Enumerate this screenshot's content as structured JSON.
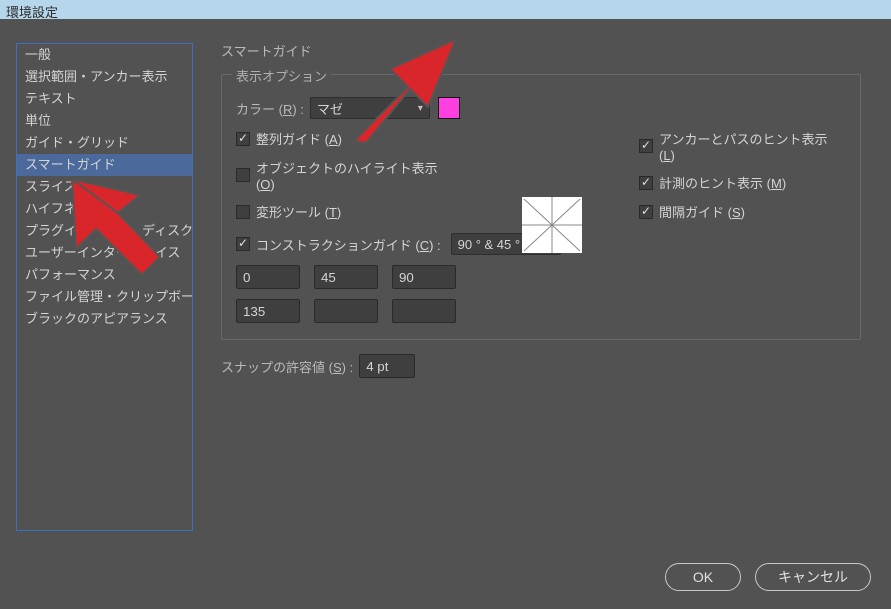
{
  "window": {
    "title": "環境設定"
  },
  "sidebar": {
    "items": [
      {
        "label": "一般"
      },
      {
        "label": "選択範囲・アンカー表示"
      },
      {
        "label": "テキスト"
      },
      {
        "label": "単位"
      },
      {
        "label": "ガイド・グリッド"
      },
      {
        "label": "スマートガイド",
        "selected": true
      },
      {
        "label": "スライス"
      },
      {
        "label": "ハイフネー"
      },
      {
        "label": "プラグイン　　　　ディスク"
      },
      {
        "label": "ユーザーインター　　イス"
      },
      {
        "label": "パフォーマンス"
      },
      {
        "label": "ファイル管理・クリップボード"
      },
      {
        "label": "ブラックのアピアランス"
      }
    ]
  },
  "panel": {
    "title": "スマートガイド",
    "display_options_legend": "表示オプション",
    "color_label_prefix": "カラー (",
    "color_label_u": "R",
    "color_label_suffix": ") :",
    "color_value": "マゼ",
    "color_swatch": "#ff3fe0",
    "checks": {
      "align": {
        "label_prefix": "整列ガイド (",
        "u": "A",
        "label_suffix": ")",
        "checked": true
      },
      "highlight": {
        "label_prefix": "オブジェクトのハイライト表示 (",
        "u": "O",
        "label_suffix": ")",
        "checked": false
      },
      "transform": {
        "label_prefix": "変形ツール (",
        "u": "T",
        "label_suffix": ")",
        "checked": false
      },
      "anchor": {
        "label_prefix": "アンカーとパスのヒント表示 (",
        "u": "L",
        "label_suffix": ")",
        "checked": true
      },
      "measure": {
        "label_prefix": "計測のヒント表示 (",
        "u": "M",
        "label_suffix": ")",
        "checked": true
      },
      "spacing": {
        "label_prefix": "間隔ガイド (",
        "u": "S",
        "label_suffix": ")",
        "checked": true
      }
    },
    "construction": {
      "label_prefix": "コンストラクションガイド (",
      "u": "C",
      "label_suffix": ") :",
      "checked": true,
      "menu_value": "90 ° & 45 °",
      "angles": [
        "0",
        "45",
        "90",
        "135",
        "",
        ""
      ]
    },
    "snap": {
      "label_prefix": "スナップの許容値 (",
      "u": "S",
      "label_suffix": ") :",
      "value": "4 pt"
    }
  },
  "footer": {
    "ok": "OK",
    "cancel": "キャンセル"
  }
}
